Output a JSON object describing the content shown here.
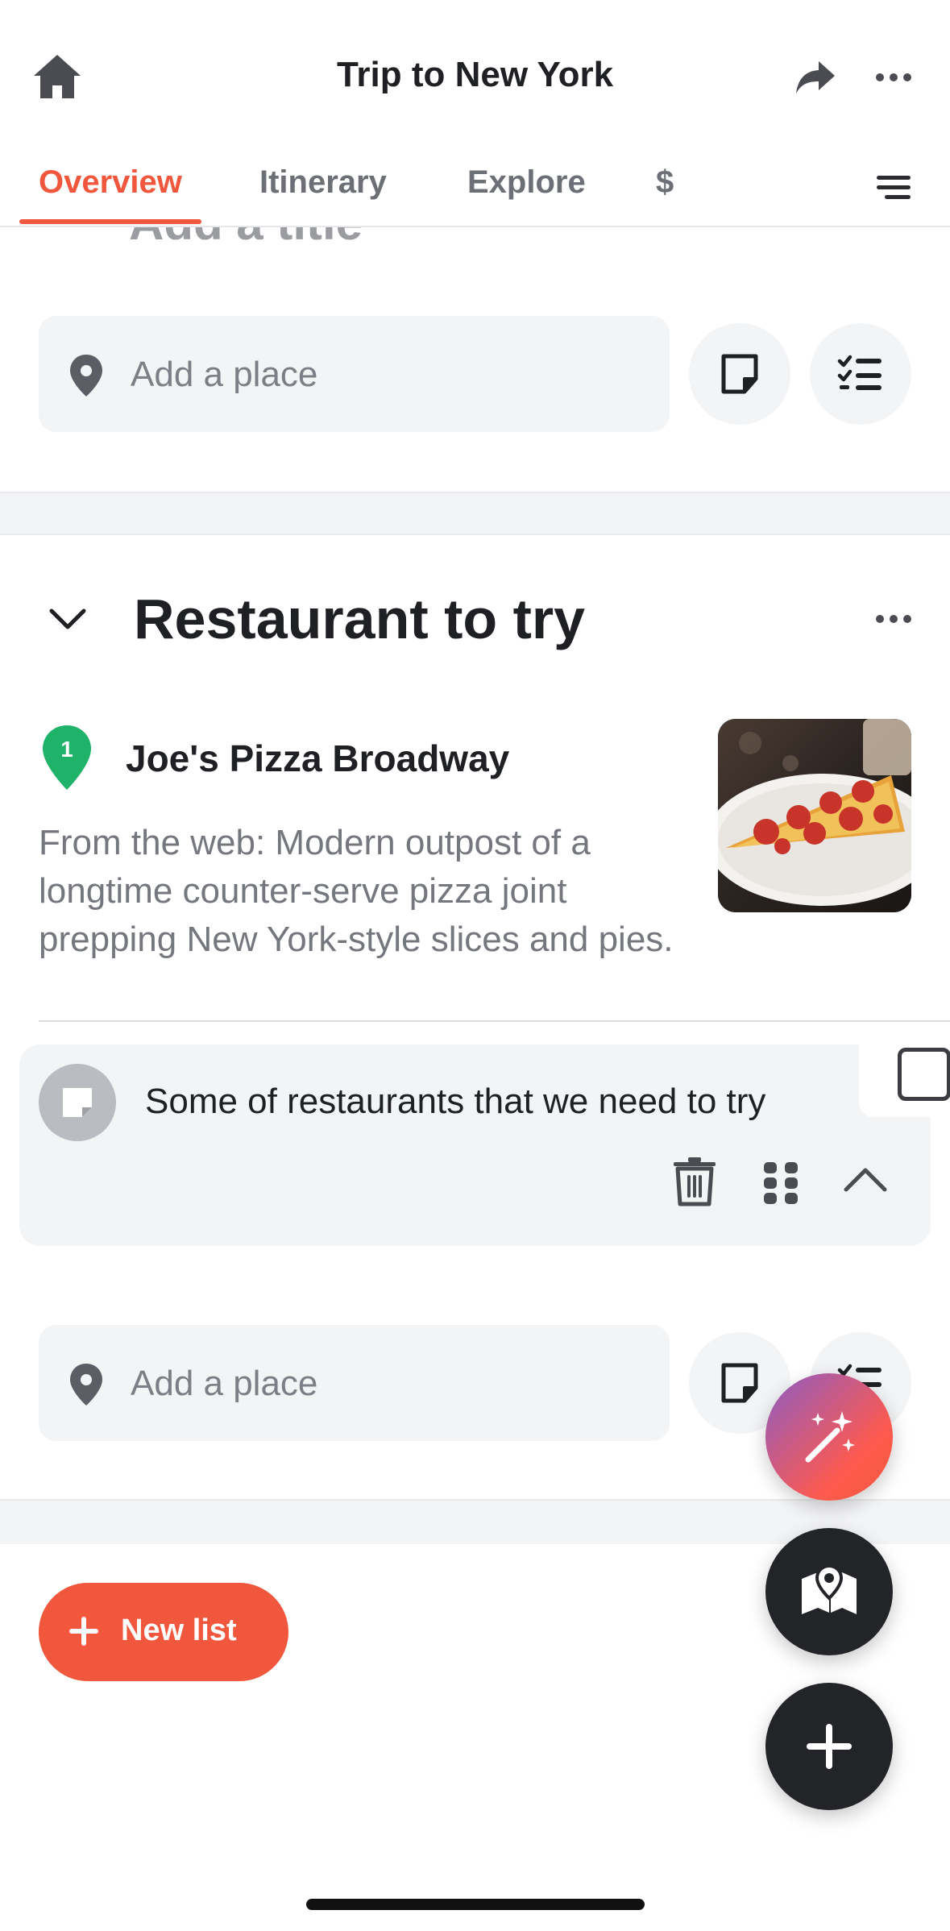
{
  "header": {
    "title": "Trip to New York"
  },
  "tabs": [
    {
      "label": "Overview",
      "active": true
    },
    {
      "label": "Itinerary",
      "active": false
    },
    {
      "label": "Explore",
      "active": false
    },
    {
      "label": "$",
      "active": false
    }
  ],
  "partial_section_title": "Add a title",
  "add_place": {
    "placeholder": "Add a place"
  },
  "section": {
    "title": "Restaurant to try"
  },
  "place": {
    "number": "1",
    "name": "Joe's Pizza Broadway",
    "description": "From the web: Modern outpost of a longtime counter-serve pizza joint prepping New York-style slices and pies."
  },
  "note": {
    "text": "Some of restaurants that we need to try"
  },
  "new_list": {
    "label": "New list"
  },
  "colors": {
    "accent": "#f0573d",
    "pin_green": "#1fb36a",
    "dark": "#232428",
    "surface": "#f3f4f6"
  },
  "icons": [
    "home-icon",
    "share-icon",
    "more-icon",
    "menu-icon",
    "map-pin-icon",
    "note-icon",
    "checklist-icon",
    "chevron-down-icon",
    "trash-icon",
    "drag-handle-icon",
    "chevron-up-icon",
    "plus-icon",
    "magic-wand-icon",
    "map-icon"
  ]
}
